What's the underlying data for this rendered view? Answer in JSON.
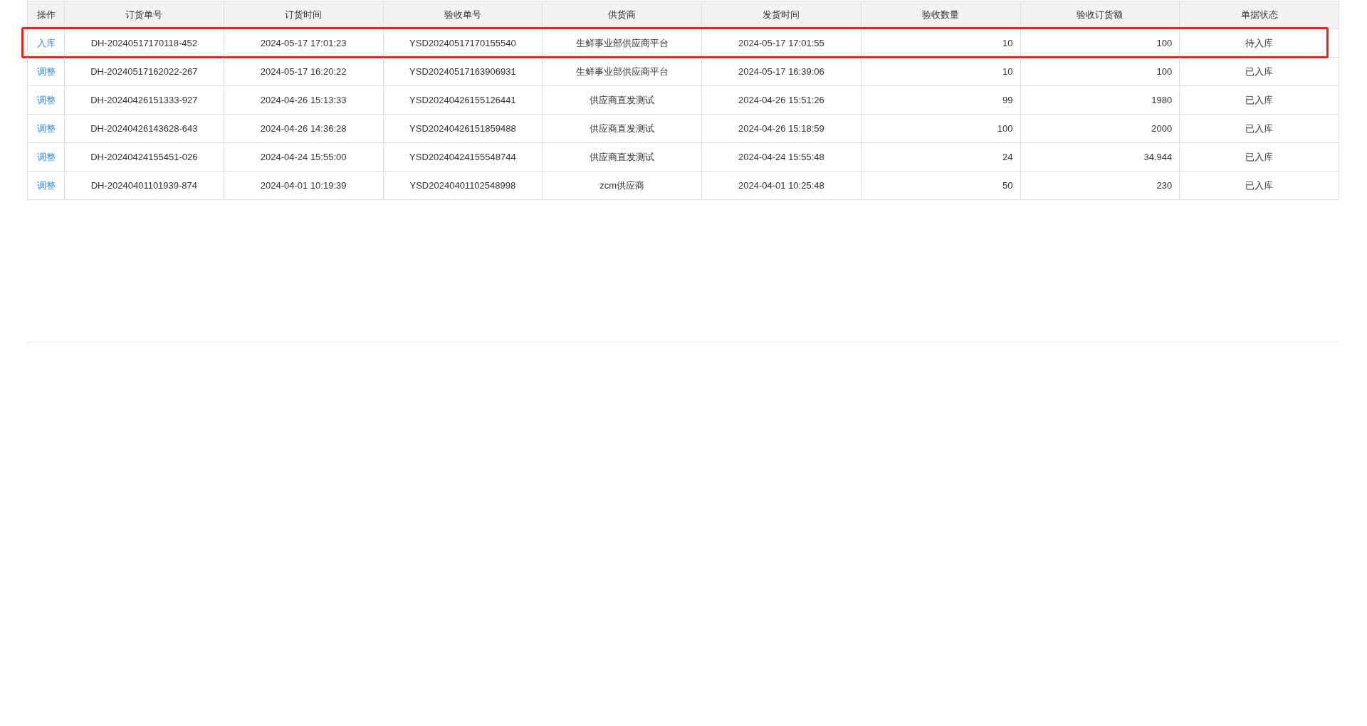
{
  "table": {
    "columns": [
      "操作",
      "订货单号",
      "订货时间",
      "验收单号",
      "供货商",
      "发货时间",
      "验收数量",
      "验收订货额",
      "单据状态"
    ],
    "rows": [
      {
        "highlighted": true,
        "cells": [
          "入库",
          "DH-20240517170118-452",
          "2024-05-17 17:01:23",
          "YSD20240517170155540",
          "生鲜事业部供应商平台",
          "2024-05-17 17:01:55",
          "10",
          "100",
          "待入库"
        ]
      },
      {
        "highlighted": false,
        "cells": [
          "调整",
          "DH-20240517162022-267",
          "2024-05-17 16:20:22",
          "YSD20240517163906931",
          "生鲜事业部供应商平台",
          "2024-05-17 16:39:06",
          "10",
          "100",
          "已入库"
        ]
      },
      {
        "highlighted": false,
        "cells": [
          "调整",
          "DH-20240426151333-927",
          "2024-04-26 15:13:33",
          "YSD20240426155126441",
          "供应商直发测试",
          "2024-04-26 15:51:26",
          "99",
          "1980",
          "已入库"
        ]
      },
      {
        "highlighted": false,
        "cells": [
          "调整",
          "DH-20240426143628-643",
          "2024-04-26 14:36:28",
          "YSD20240426151859488",
          "供应商直发测试",
          "2024-04-26 15:18:59",
          "100",
          "2000",
          "已入库"
        ]
      },
      {
        "highlighted": false,
        "cells": [
          "调整",
          "DH-20240424155451-026",
          "2024-04-24 15:55:00",
          "YSD20240424155548744",
          "供应商直发测试",
          "2024-04-24 15:55:48",
          "24",
          "34.944",
          "已入库"
        ]
      },
      {
        "highlighted": false,
        "cells": [
          "调整",
          "DH-20240401101939-874",
          "2024-04-01 10:19:39",
          "YSD20240401102548998",
          "zcm供应商",
          "2024-04-01 10:25:48",
          "50",
          "230",
          "已入库"
        ]
      }
    ]
  }
}
